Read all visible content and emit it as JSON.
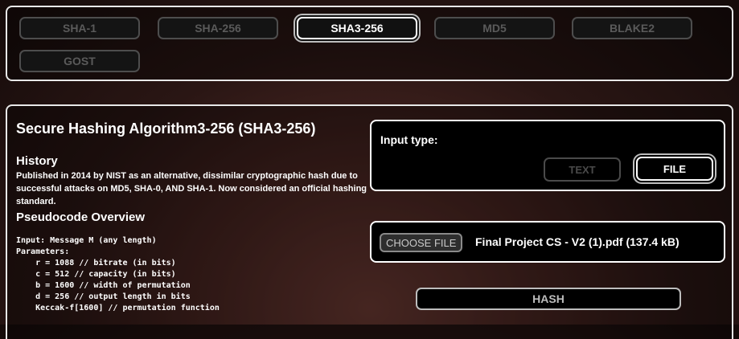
{
  "algorithms": [
    {
      "label": "SHA-1"
    },
    {
      "label": "SHA-256"
    },
    {
      "label": "SHA3-256",
      "selected": true
    },
    {
      "label": "MD5"
    },
    {
      "label": "BLAKE2"
    },
    {
      "label": "GOST"
    }
  ],
  "info": {
    "title": "Secure Hashing Algorithm3-256 (SHA3-256)",
    "history_heading": "History",
    "history_text": "Published in 2014 by NIST as an alternative, dissimilar cryptographic hash due to successful attacks on MD5, SHA-0, AND SHA-1. Now considered an official hashing standard.",
    "pseudo_heading": "Pseudocode Overview",
    "pseudocode": "Input: Message M (any length)\nParameters:\n    r = 1088 // bitrate (in bits)\n    c = 512 // capacity (in bits)\n    b = 1600 // width of permutation\n    d = 256 // output length in bits\n    Keccak-f[1600] // permutation function"
  },
  "input_type": {
    "label": "Input type:",
    "text_button": "TEXT",
    "file_button": "FILE",
    "selected": "FILE"
  },
  "file": {
    "choose_button": "CHOOSE FILE",
    "file_name": "Final Project CS - V2 (1).pdf (137.4 kB)"
  },
  "hash_button": "HASH",
  "colors": {
    "accent": "#ffffff",
    "disabled": "#4a4a4a"
  }
}
